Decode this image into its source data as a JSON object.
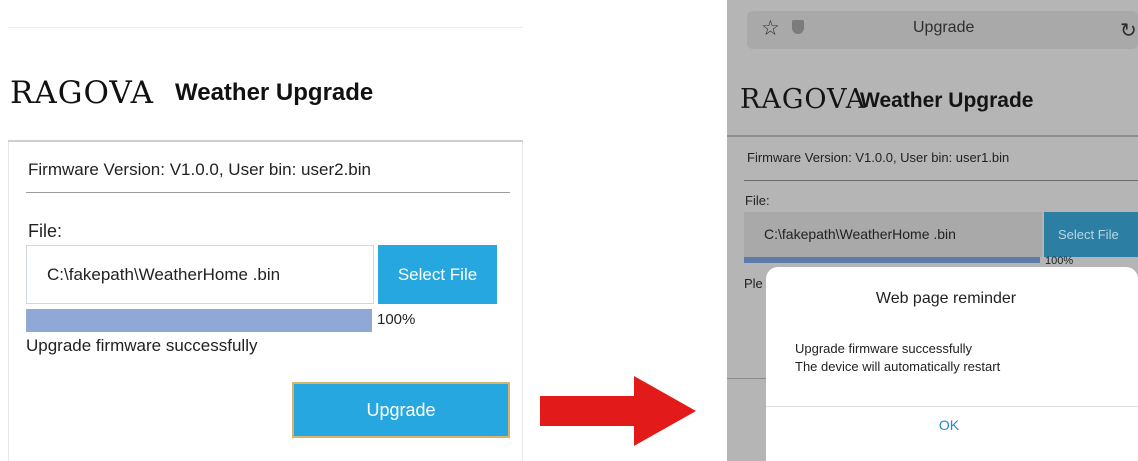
{
  "colors": {
    "accent_blue": "#27a7df",
    "progress_fill": "#8fa8d6",
    "arrow_red": "#e21a1a",
    "ok_link": "#2789c9"
  },
  "left": {
    "logo": "RAGOVA",
    "title": "Weather Upgrade",
    "firmware_info": "Firmware Version: V1.0.0, User bin: user2.bin",
    "file_label": "File:",
    "file_value": "C:\\fakepath\\WeatherHome .bin",
    "select_file_label": "Select File",
    "progress_value": 100,
    "progress_text": "100%",
    "status_message": "Upgrade firmware successfully",
    "upgrade_label": "Upgrade"
  },
  "arrow": {
    "icon": "right-arrow-icon"
  },
  "right": {
    "browser": {
      "title": "Upgrade",
      "star_icon": "star-icon",
      "shield_icon": "shield-icon",
      "reload_icon": "reload-icon"
    },
    "logo": "RAGOVA",
    "title": "Weather  Upgrade",
    "firmware_info": "Firmware Version: V1.0.0, User bin: user1.bin",
    "file_label": "File:",
    "file_value": "C:\\fakepath\\WeatherHome .bin",
    "select_file_label": "Select File",
    "progress_value": 100,
    "progress_text": "100%",
    "partial_text": "Ple",
    "dialog": {
      "title": "Web page reminder",
      "line1": "Upgrade firmware successfully",
      "line2": "The device will automatically restart",
      "ok_label": "OK"
    }
  }
}
